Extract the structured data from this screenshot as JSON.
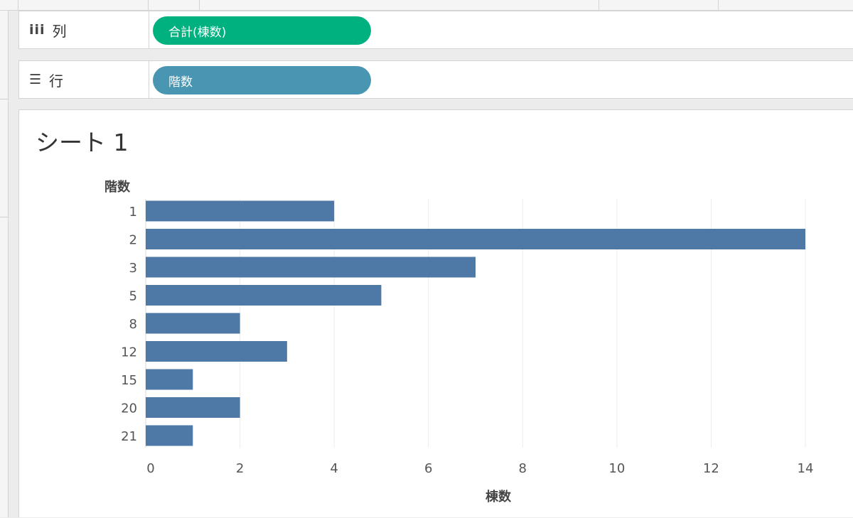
{
  "shelves": {
    "columns": {
      "label": "列",
      "icon": "column-shelf-icon",
      "pill": "合計(棟数)",
      "pill_color": "#00b180"
    },
    "rows": {
      "label": "行",
      "icon": "row-shelf-icon",
      "pill": "階数",
      "pill_color": "#4996b2"
    }
  },
  "sheet": {
    "title": "シート 1"
  },
  "chart_data": {
    "type": "bar",
    "orientation": "horizontal",
    "categories": [
      "1",
      "2",
      "3",
      "5",
      "8",
      "12",
      "15",
      "20",
      "21"
    ],
    "values": [
      4,
      14,
      7,
      5,
      2,
      3,
      1,
      2,
      1
    ],
    "xlabel": "棟数",
    "ylabel": "階数",
    "xlim": [
      0,
      14
    ],
    "xticks": [
      0,
      2,
      4,
      6,
      8,
      10,
      12,
      14
    ],
    "grid": true,
    "bar_color": "#4e79a7"
  }
}
